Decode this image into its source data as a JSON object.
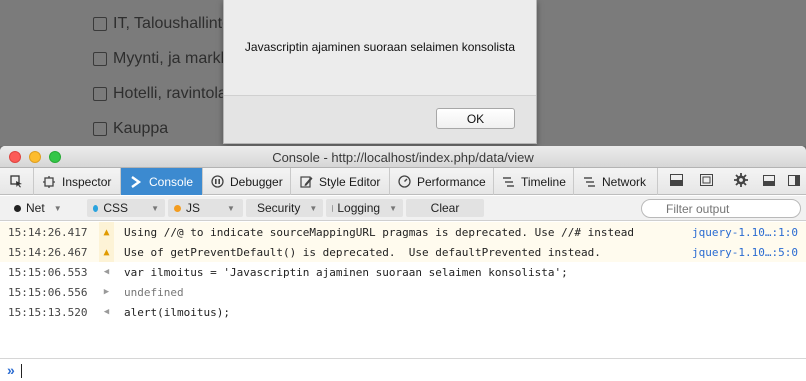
{
  "page": {
    "items": [
      "IT, Taloushallinto ja hallinto",
      "Myynti, ja markkinointi",
      "Hotelli, ravintola ja catering",
      "Kauppa"
    ]
  },
  "dialog": {
    "message": "Javascriptin ajaminen suoraan selaimen konsolista",
    "ok_label": "OK"
  },
  "window": {
    "title": "Console - http://localhost/index.php/data/view"
  },
  "toolbar": {
    "tabs": [
      {
        "label": "Inspector",
        "icon": "inspector-icon"
      },
      {
        "label": "Console",
        "icon": "console-icon",
        "active": true
      },
      {
        "label": "Debugger",
        "icon": "debugger-icon"
      },
      {
        "label": "Style Editor",
        "icon": "style-editor-icon"
      },
      {
        "label": "Performance",
        "icon": "performance-icon"
      },
      {
        "label": "Timeline",
        "icon": "timeline-icon"
      },
      {
        "label": "Network",
        "icon": "network-icon"
      }
    ]
  },
  "filters": {
    "net": "Net",
    "css": "CSS",
    "js": "JS",
    "security": "Security",
    "logging": "Logging",
    "clear": "Clear",
    "placeholder": "Filter output",
    "colors": {
      "net": "#222222",
      "css": "#2aa3de",
      "js": "#f39c1f",
      "security": "#e0413a",
      "logging": "#9a9a9a"
    }
  },
  "console": {
    "rows": [
      {
        "time": "15:14:26.417",
        "kind": "warn",
        "text": "Using //@ to indicate sourceMappingURL pragmas is deprecated. Use //# instead",
        "source": "jquery-1.10…:1:0"
      },
      {
        "time": "15:14:26.467",
        "kind": "warn",
        "text": "Use of getPreventDefault() is deprecated.  Use defaultPrevented instead.",
        "source": "jquery-1.10…:5:0"
      },
      {
        "time": "15:15:06.553",
        "kind": "in",
        "text": "var ilmoitus = 'Javascriptin ajaminen suoraan selaimen konsolista';",
        "source": ""
      },
      {
        "time": "15:15:06.556",
        "kind": "out",
        "text": "undefined",
        "source": ""
      },
      {
        "time": "15:15:13.520",
        "kind": "in",
        "text": "alert(ilmoitus);",
        "source": ""
      }
    ],
    "prompt": "»"
  }
}
